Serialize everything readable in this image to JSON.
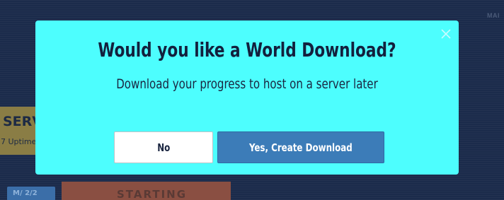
{
  "background": {
    "nav_label": "MAI",
    "server_card": {
      "title": "SERV",
      "subtitle": "7 Uptime"
    },
    "tag": "M/ 2/2",
    "status_button": "STARTING"
  },
  "dialog": {
    "title": "Would you like a World Download?",
    "subtitle": "Download your progress to host on a server later",
    "close_icon": "close-icon",
    "buttons": {
      "no_label": "No",
      "yes_label": "Yes, Create Download"
    }
  },
  "colors": {
    "dialog_bg": "#4dfefe",
    "primary_button": "#3c7cb8",
    "page_bg": "#1b2b4b"
  }
}
